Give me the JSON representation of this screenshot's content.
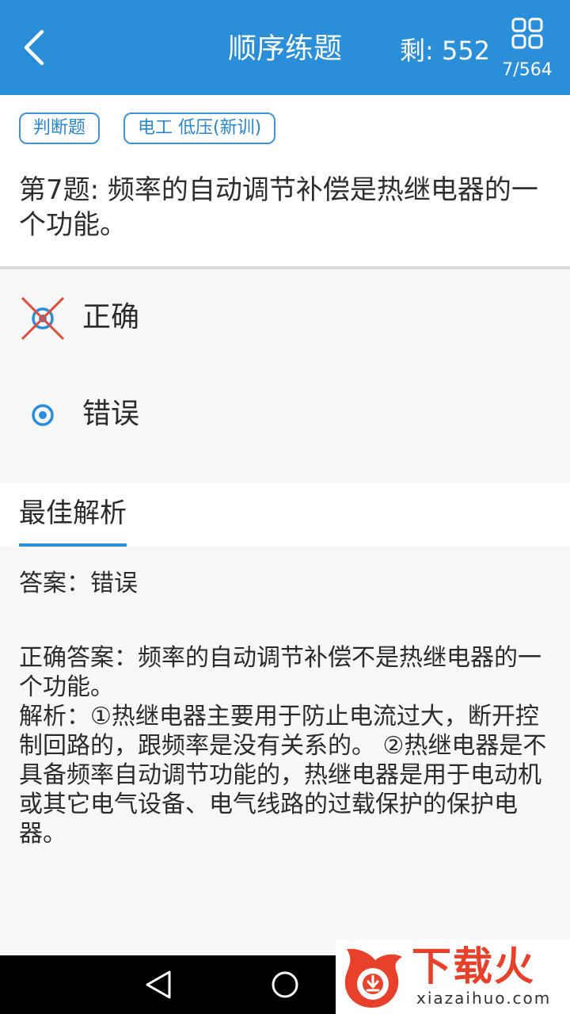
{
  "header": {
    "title": "顺序练题",
    "remaining_label": "剩: 552",
    "progress": "7/564",
    "back_icon": "chevron-left-icon",
    "grid_icon": "grid-icon",
    "bar_color": "#2a8fd8"
  },
  "question": {
    "tags": [
      "判断题",
      "电工 低压(新训)"
    ],
    "text": "第7题: 频率的自动调节补偿是热继电器的一个功能。"
  },
  "options": [
    {
      "label": "正确",
      "state": "wrong-selected",
      "icon": "cross-radio-icon"
    },
    {
      "label": "错误",
      "state": "correct",
      "icon": "radio-selected-icon"
    }
  ],
  "analysis": {
    "tab_label": "最佳解析",
    "answer": "答案：错误",
    "lines": [
      "正确答案：频率的自动调节补偿不是热继电器的一个功能。",
      "解析：①热继电器主要用于防止电流过大，断开控制回路的，跟频率是没有关系的。 ②热继电器是不具备频率自动调节功能的，热继电器是用于电动机或其它电气设备、电气线路的过载保护的保护电器。"
    ]
  },
  "navbar": {
    "back_icon": "triangle-back-icon",
    "home_icon": "circle-home-icon"
  },
  "watermark": {
    "title": "下载火",
    "subtitle": "xiazaihuo.com",
    "logo_icon": "flame-logo-icon",
    "color": "#e8412b"
  }
}
